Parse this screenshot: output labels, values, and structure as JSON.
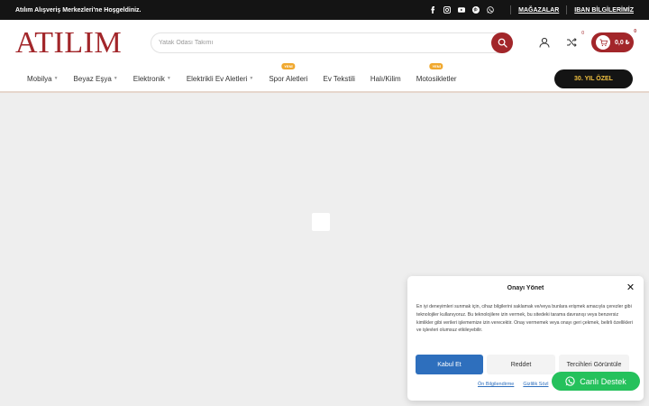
{
  "topbar": {
    "welcome": "Atılım Alışveriş Merkezleri'ne Hoşgeldiniz.",
    "social_icons": [
      "facebook-icon",
      "instagram-icon",
      "youtube-icon",
      "pinterest-icon",
      "whatsapp-icon"
    ],
    "links": [
      "MAĞAZALAR",
      "IBAN BİLGİLERİMİZ"
    ]
  },
  "header": {
    "logo": "ATILIM",
    "search_placeholder": "Yatak Odası Takımı",
    "compare_count": "0",
    "cart_count": "0",
    "cart_total": "0,0 ₺"
  },
  "nav": {
    "items": [
      {
        "label": "Mobilya",
        "has_dropdown": true,
        "new": ""
      },
      {
        "label": "Beyaz Eşya",
        "has_dropdown": true,
        "new": ""
      },
      {
        "label": "Elektronik",
        "has_dropdown": true,
        "new": ""
      },
      {
        "label": "Elektrikli Ev Aletleri",
        "has_dropdown": true,
        "new": ""
      },
      {
        "label": "Spor Aletleri",
        "has_dropdown": false,
        "new": "YENİ"
      },
      {
        "label": "Ev Tekstili",
        "has_dropdown": false,
        "new": ""
      },
      {
        "label": "Halı/Kilim",
        "has_dropdown": false,
        "new": ""
      },
      {
        "label": "Motosikletler",
        "has_dropdown": false,
        "new": "YENİ"
      }
    ],
    "promo": "30. YIL ÖZEL"
  },
  "consent": {
    "title": "Onayı Yönet",
    "body": "En iyi deneyimleri sunmak için, cihaz bilgilerini saklamak ve/veya bunlara erişmek amacıyla çerezler gibi teknolojiler kullanıyoruz. Bu teknolojilere izin vermek, bu sitedeki tarama davranışı veya benzersiz kimlikler gibi verileri işlememize izin verecektir. Onay vermemek veya onayı geri çekmek, belirli özellikleri ve işlevleri olumsuz etkileyebilir.",
    "accept": "Kabul Et",
    "reject": "Reddet",
    "preferences": "Tercihleri Görüntüle",
    "links": [
      "Ön Bilgilendirme",
      "Gizlilik Sözl"
    ]
  },
  "chat": {
    "label": "Canlı Destek"
  },
  "colors": {
    "brand": "#a2262a",
    "accept": "#2e6fbd",
    "chat": "#25c15c",
    "new_badge": "#f0a82e"
  }
}
